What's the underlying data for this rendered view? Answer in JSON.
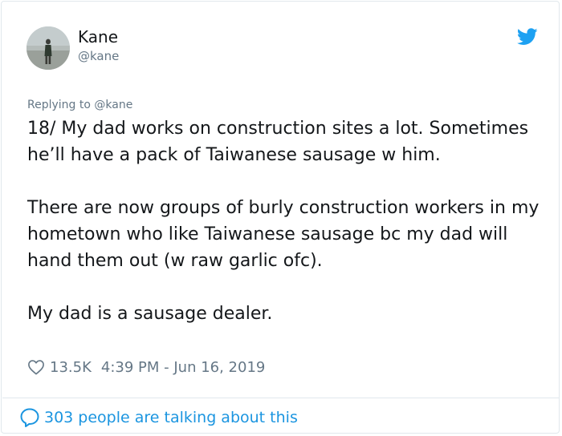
{
  "user": {
    "name": "Kane",
    "handle": "@kane",
    "avatar": "avatar"
  },
  "brand": {
    "icon": "twitter-bird-icon",
    "color": "#1da1f2"
  },
  "tweet": {
    "replying_to": "Replying to @kane",
    "paragraph_1": "18/ My dad works on construction sites a lot. Sometimes he’ll have a pack of Taiwanese sausage w him.",
    "paragraph_2": "There are now groups of burly construction workers in my hometown who like Taiwanese sausage bc my dad will hand them out (w raw garlic ofc).",
    "paragraph_3": "My dad is a sausage dealer."
  },
  "meta": {
    "heart_icon": "heart-icon",
    "likes": "13.5K",
    "timestamp": "4:39 PM - Jun 16, 2019"
  },
  "footer": {
    "icon": "speech-bubble-icon",
    "label": "303 people are talking about this",
    "link_color": "#1b95e0"
  }
}
